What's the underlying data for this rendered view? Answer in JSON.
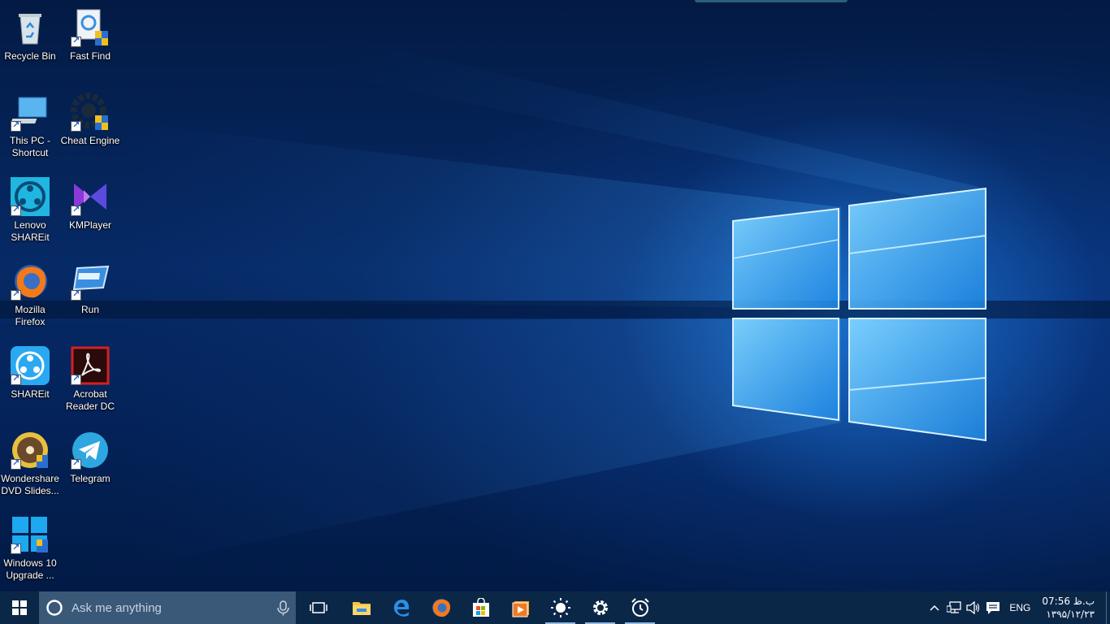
{
  "desktop": {
    "icons": [
      {
        "label": "Recycle Bin",
        "icon": "recycle-bin-icon"
      },
      {
        "label": "Fast Find",
        "icon": "fast-find-icon"
      },
      {
        "label": "This PC - Shortcut",
        "icon": "this-pc-icon"
      },
      {
        "label": "Cheat Engine",
        "icon": "cheat-engine-icon"
      },
      {
        "label": "Lenovo SHAREit",
        "icon": "lenovo-shareit-icon"
      },
      {
        "label": "KMPlayer",
        "icon": "kmplayer-icon"
      },
      {
        "label": "Mozilla Firefox",
        "icon": "firefox-icon"
      },
      {
        "label": "Run",
        "icon": "run-icon"
      },
      {
        "label": "SHAREit",
        "icon": "shareit-icon"
      },
      {
        "label": "Acrobat Reader DC",
        "icon": "acrobat-reader-icon"
      },
      {
        "label": "Wondershare DVD Slides...",
        "icon": "wondershare-dvd-icon"
      },
      {
        "label": "Telegram",
        "icon": "telegram-icon"
      },
      {
        "label": "Windows 10 Upgrade ...",
        "icon": "windows-10-upgrade-icon"
      }
    ]
  },
  "taskbar": {
    "search_placeholder": "Ask me anything",
    "pinned": [
      {
        "name": "task-view",
        "icon": "task-view-icon"
      },
      {
        "name": "file-explorer",
        "icon": "folder-icon"
      },
      {
        "name": "edge",
        "icon": "edge-icon"
      },
      {
        "name": "firefox",
        "icon": "firefox-icon"
      },
      {
        "name": "store",
        "icon": "store-icon"
      },
      {
        "name": "media-player",
        "icon": "media-player-icon"
      },
      {
        "name": "brightness",
        "icon": "sun-icon"
      },
      {
        "name": "settings",
        "icon": "gear-icon"
      },
      {
        "name": "alarms",
        "icon": "alarm-clock-icon"
      }
    ],
    "tray": {
      "language": "ENG",
      "time": "07:56 ب.ظ",
      "date": "۱۳۹۵/۱۲/۲۳"
    }
  },
  "colors": {
    "taskbar": "#0b2748",
    "search_box": "#3a5878",
    "wallpaper_glow": "#2896ff"
  }
}
